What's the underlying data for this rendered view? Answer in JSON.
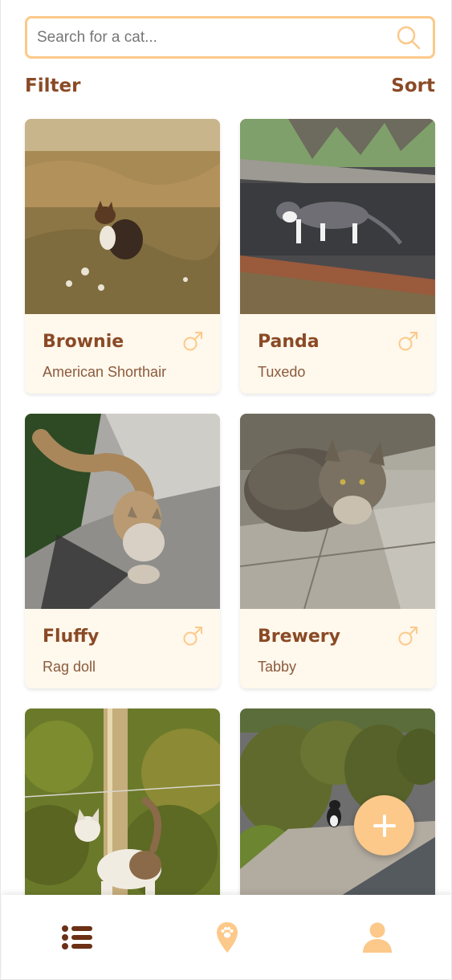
{
  "search": {
    "placeholder": "Search for a cat...",
    "value": "",
    "icon": "search-icon"
  },
  "toolbar": {
    "filter_label": "Filter",
    "sort_label": "Sort"
  },
  "cats": [
    {
      "name": "Brownie",
      "breed": "American Shorthair",
      "sex": "male",
      "sex_icon": "male-icon",
      "photo": "calico cat in dry grass field"
    },
    {
      "name": "Panda",
      "breed": "Tuxedo",
      "sex": "male",
      "sex_icon": "male-icon",
      "photo": "gray and white cat on pavement near planter"
    },
    {
      "name": "Fluffy",
      "breed": "Rag doll",
      "sex": "male",
      "sex_icon": "male-icon",
      "photo": "fluffy tan cat on concrete walkway"
    },
    {
      "name": "Brewery",
      "breed": "Tabby",
      "sex": "male",
      "sex_icon": "male-icon",
      "photo": "long-haired tabby cat lying on pavement"
    },
    {
      "name": "",
      "breed": "",
      "sex": "",
      "photo": "calico cat near wooden post and hedge"
    },
    {
      "name": "",
      "breed": "",
      "sex": "",
      "photo": "black and white cat near round hedges"
    }
  ],
  "fab": {
    "icon": "plus-icon"
  },
  "bottom_nav": [
    {
      "name": "list",
      "icon": "list-icon",
      "active": true
    },
    {
      "name": "map",
      "icon": "map-pin-paw-icon",
      "active": false
    },
    {
      "name": "profile",
      "icon": "user-icon",
      "active": false
    }
  ],
  "colors": {
    "accent": "#fcc98a",
    "brand_text": "#8a4a26",
    "card_info_bg": "#fff8ec",
    "active_nav": "#6b3015"
  }
}
